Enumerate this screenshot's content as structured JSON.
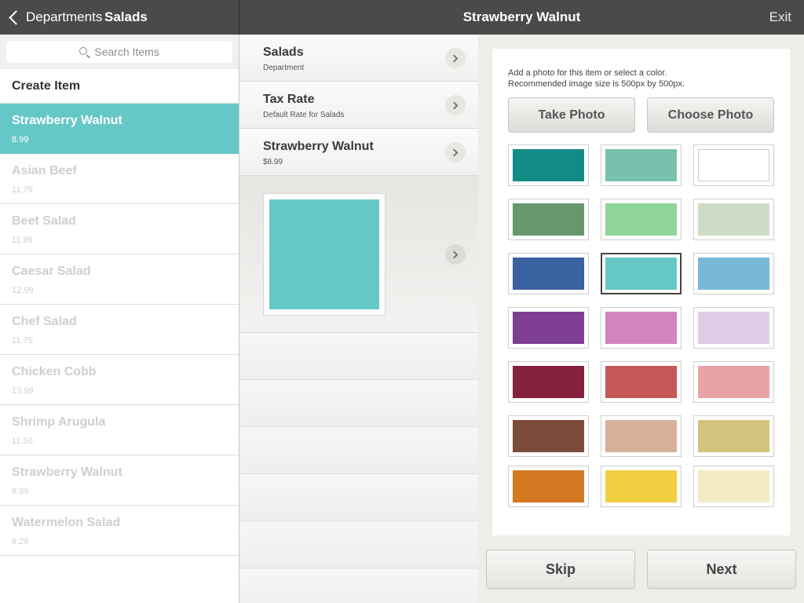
{
  "topbar": {
    "back_label": "Departments",
    "left_title": "Salads",
    "center_title": "Strawberry Walnut",
    "exit_label": "Exit"
  },
  "sidebar": {
    "search_placeholder": "Search Items",
    "create_label": "Create Item",
    "items": [
      {
        "name": "Strawberry Walnut",
        "price": "8.99",
        "selected": true
      },
      {
        "name": "Asian Beef",
        "price": "11.75"
      },
      {
        "name": "Beet Salad",
        "price": "11.99"
      },
      {
        "name": "Caesar Salad",
        "price": "12.99"
      },
      {
        "name": "Chef Salad",
        "price": "11.75"
      },
      {
        "name": "Chicken Cobb",
        "price": "13.99"
      },
      {
        "name": "Shrimp Arugula",
        "price": "11.50"
      },
      {
        "name": "Strawberry Walnut",
        "price": "8.99"
      },
      {
        "name": "Watermelon Salad",
        "price": "9.29"
      }
    ]
  },
  "details": {
    "rows": [
      {
        "title": "Salads",
        "subtitle": "Department"
      },
      {
        "title": "Tax Rate",
        "subtitle": "Default Rate for Salads"
      },
      {
        "title": "Strawberry Walnut",
        "subtitle": "$8.99"
      }
    ],
    "preview_color": "#66c8c6"
  },
  "color_picker": {
    "hint_line1": "Add a photo for this item or select a color.",
    "hint_line2": "Recommended image size is 500px by 500px.",
    "take_photo_label": "Take Photo",
    "choose_photo_label": "Choose Photo",
    "selected_color": "#66c8c6",
    "colors": [
      [
        "#128b87",
        "#78c1ad",
        "#ffffff"
      ],
      [
        "#66986e",
        "#8fd597",
        "#cfdcc5"
      ],
      [
        "#3a61a0",
        "#66c8c6",
        "#78b9d8"
      ],
      [
        "#7e3f92",
        "#d484be",
        "#e1cbe6"
      ],
      [
        "#85213c",
        "#c75757",
        "#eaa3a4"
      ],
      [
        "#7d4b3a",
        "#d8b09a",
        "#d4c37c"
      ],
      [
        "#d47822",
        "#efcf40",
        "#f4ebc6"
      ]
    ]
  },
  "footer": {
    "skip_label": "Skip",
    "next_label": "Next"
  }
}
